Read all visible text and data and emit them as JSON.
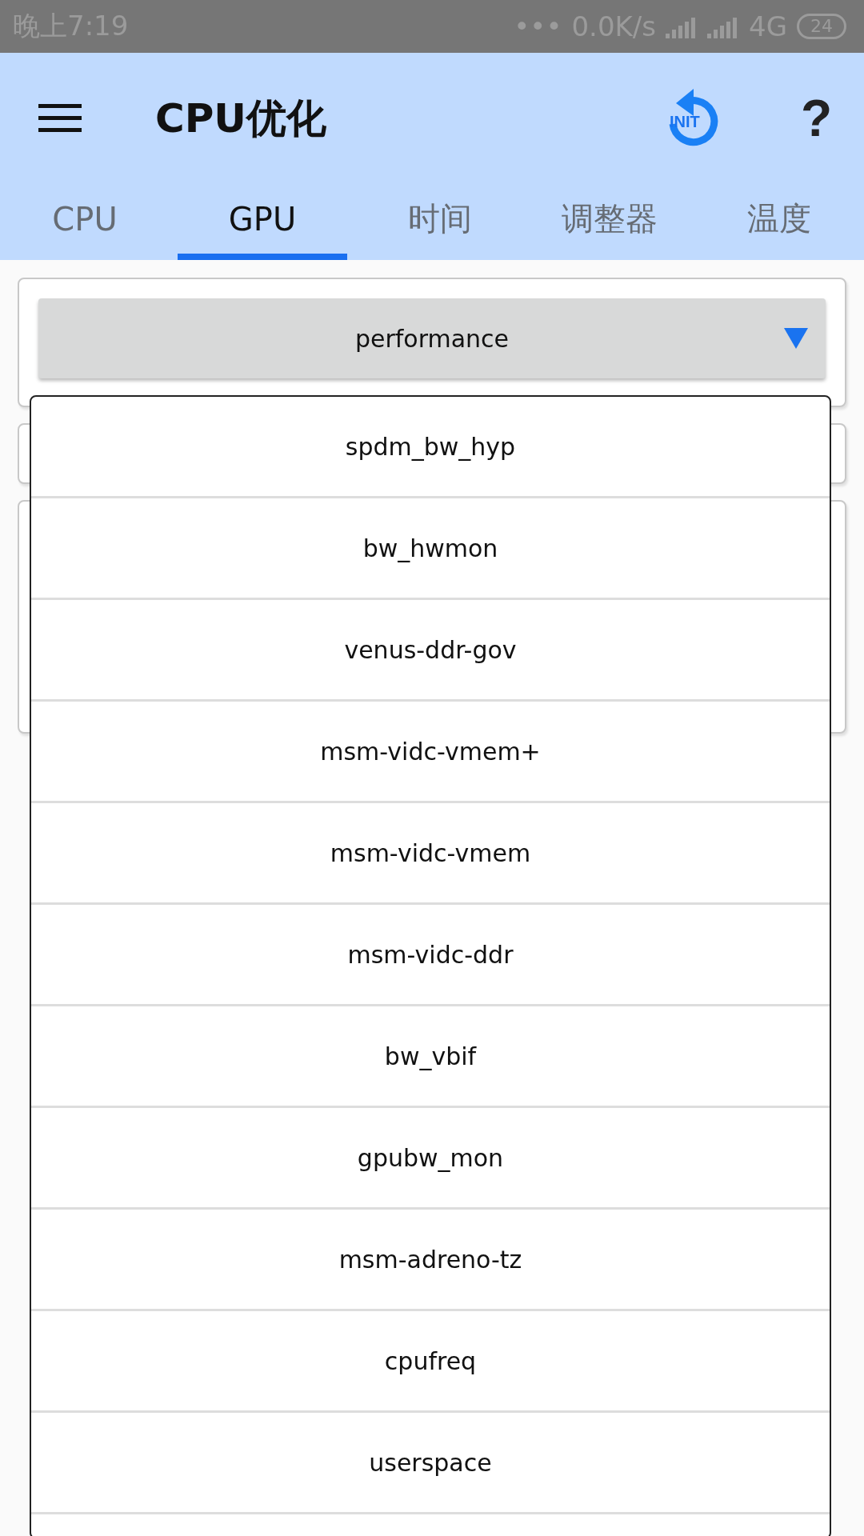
{
  "status_bar": {
    "time": "晚上7:19",
    "dots": "•••",
    "network_speed": "0.0K/s",
    "network_type": "4G",
    "battery": "24"
  },
  "app_bar": {
    "title": "CPU优化",
    "init_label": "INIT",
    "help": "?"
  },
  "tabs": [
    {
      "label": "CPU",
      "selected": false
    },
    {
      "label": "GPU",
      "selected": true
    },
    {
      "label": "时间",
      "selected": false
    },
    {
      "label": "调整器",
      "selected": false
    },
    {
      "label": "温度",
      "selected": false
    }
  ],
  "governor_select": {
    "value": "performance"
  },
  "dropdown": {
    "items": [
      "spdm_bw_hyp",
      "bw_hwmon",
      "venus-ddr-gov",
      "msm-vidc-vmem+",
      "msm-vidc-vmem",
      "msm-vidc-ddr",
      "bw_vbif",
      "gpubw_mon",
      "msm-adreno-tz",
      "cpufreq",
      "userspace"
    ]
  }
}
